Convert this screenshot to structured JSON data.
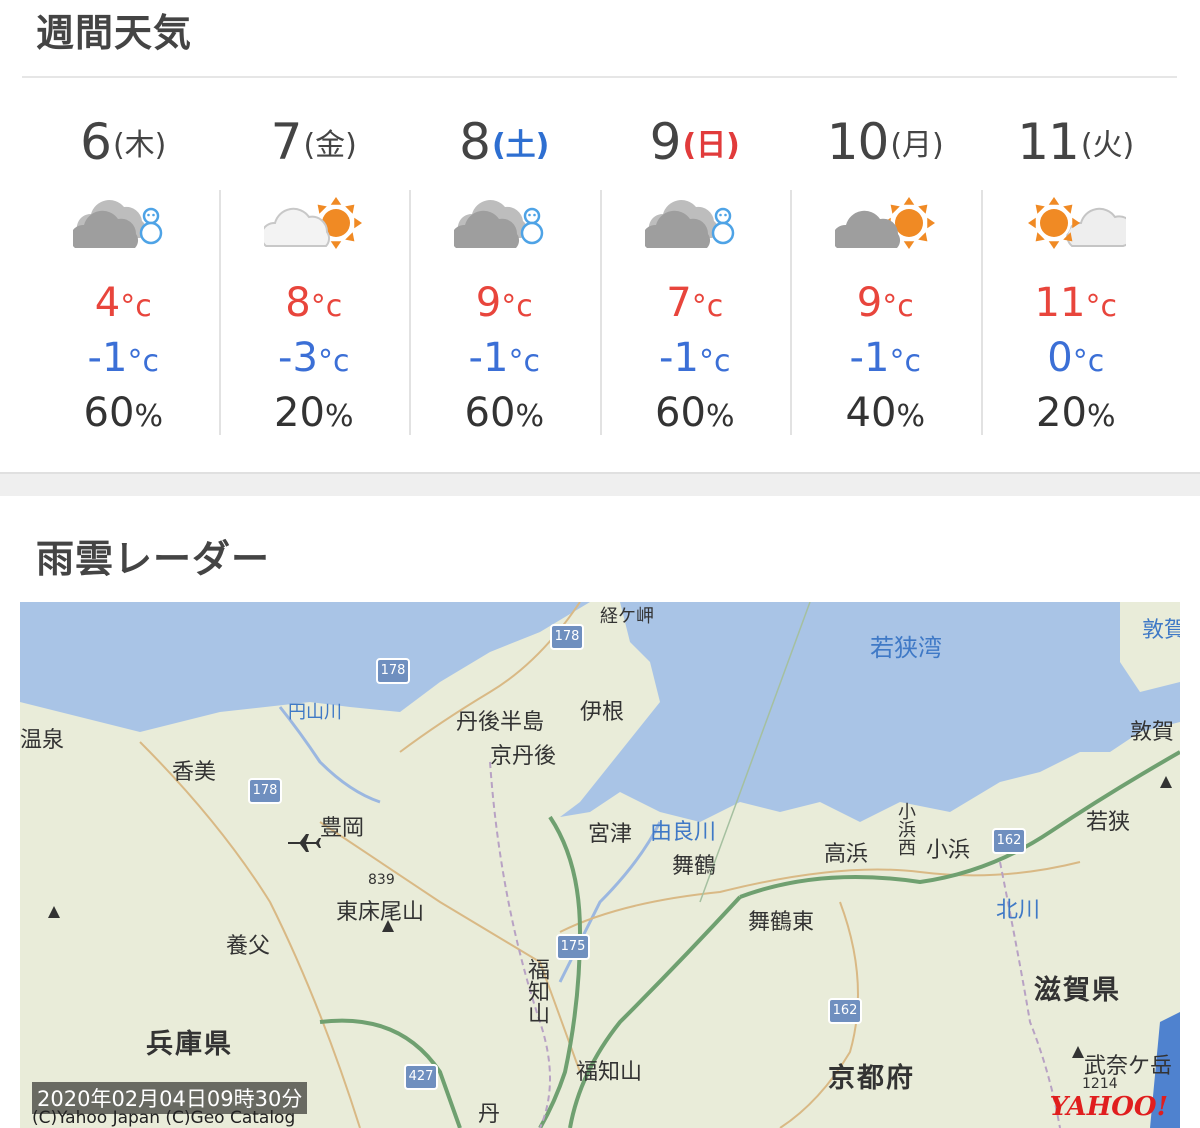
{
  "weekly": {
    "title": "週間天気",
    "days": [
      {
        "num": "6",
        "weekday": "(木)",
        "icon": "cloud-snow-icon",
        "high": "4",
        "low": "-1",
        "precip": "60"
      },
      {
        "num": "7",
        "weekday": "(金)",
        "icon": "cloud-sun-icon",
        "high": "8",
        "low": "-3",
        "precip": "20"
      },
      {
        "num": "8",
        "weekday": "(土)",
        "icon": "cloud-snow-icon",
        "high": "9",
        "low": "-1",
        "precip": "60"
      },
      {
        "num": "9",
        "weekday": "(日)",
        "icon": "cloud-snow-icon",
        "high": "7",
        "low": "-1",
        "precip": "60"
      },
      {
        "num": "10",
        "weekday": "(月)",
        "icon": "cloud-sun-icon",
        "high": "9",
        "low": "-1",
        "precip": "40"
      },
      {
        "num": "11",
        "weekday": "(火)",
        "icon": "sun-cloud-icon",
        "high": "11",
        "low": "0",
        "precip": "20"
      }
    ],
    "temp_unit": "°c",
    "precip_unit": "%",
    "colors": {
      "high": "#e8453c",
      "low": "#3b6fd6",
      "saturday": "#2e6fd1",
      "sunday": "#e13b3b",
      "sun": "#f08a24",
      "cloud": "#9e9e9e"
    }
  },
  "radar": {
    "title": "雨雲レーダー",
    "timestamp": "2020年02月04日09時30分",
    "copyright": "(C)Yahoo Japan (C)Geo Catalog",
    "logo": "YAHOO!",
    "map_labels": {
      "wakasa_bay": "若狭湾",
      "tsuruga": "敦賀",
      "tsuruga2": "敦賀",
      "kyoutango": "京丹後",
      "tangohanto": "丹後半島",
      "ine": "伊根",
      "miyazu": "宮津",
      "maizuru": "舞鶴",
      "maizuruhigashi": "舞鶴東",
      "takahama": "高浜",
      "obama": "小浜",
      "obamanishi": "小浜西",
      "wakasa": "若狭",
      "kamiokazaki": "香美",
      "toyooka": "豊岡",
      "higashitokoro": "東床尾山",
      "yabu": "養父",
      "fukuchiyama": "福知山",
      "fukuchiyama_v": "福知山",
      "hyogo": "兵庫県",
      "kyoto": "京都府",
      "shiga": "滋賀県",
      "bukigatake": "武奈ケ岳",
      "onsen": "温泉",
      "maruyama": "円山川",
      "yurakawa": "由良川",
      "kitagawa": "北川",
      "kyogamisaki": "経ケ岬",
      "tan": "丹",
      "elev839": "839",
      "elev1214": "1214"
    },
    "routes": [
      "178",
      "178",
      "178",
      "175",
      "162",
      "162",
      "427"
    ]
  }
}
